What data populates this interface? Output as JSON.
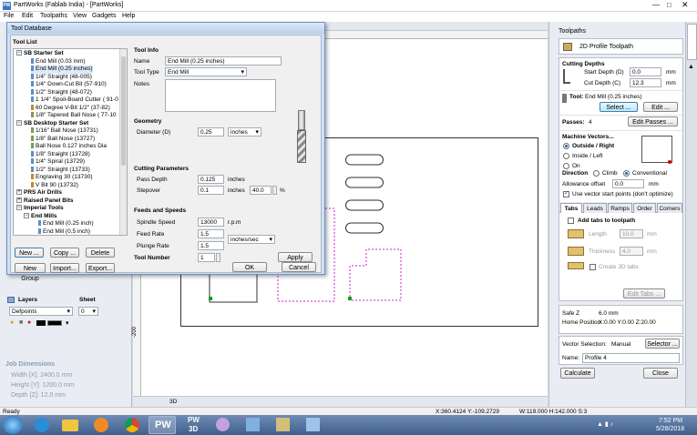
{
  "window": {
    "title": "PartWorks (Fablab India) - [PartWorks]",
    "menu": [
      "File",
      "Edit",
      "Toolpaths",
      "View",
      "Gadgets",
      "Help"
    ]
  },
  "tool_db": {
    "title": "Tool Database",
    "tool_list_label": "Tool List",
    "tree": [
      {
        "label": "SB Starter Set",
        "depth": 0,
        "bold": true,
        "expander": "−",
        "icon": ""
      },
      {
        "label": "End Mill (0.03 mm)",
        "depth": 2,
        "bold": false,
        "expander": "",
        "icon": "endmill"
      },
      {
        "label": "End Mill (0.25 inches)",
        "depth": 2,
        "bold": false,
        "expander": "",
        "icon": "endmill"
      },
      {
        "label": "1/4\" Straight  (48-005)",
        "depth": 2,
        "bold": false,
        "expander": "",
        "icon": "endmill"
      },
      {
        "label": "1/4\"  Down-Cut Bit (57-910)",
        "depth": 2,
        "bold": false,
        "expander": "",
        "icon": "endmill"
      },
      {
        "label": "1/2\" Straight  (48-072)",
        "depth": 2,
        "bold": false,
        "expander": "",
        "icon": "endmill"
      },
      {
        "label": "1 1/4\" Spoil-Board Cutter ( 91-0",
        "depth": 2,
        "bold": false,
        "expander": "",
        "icon": "endmill"
      },
      {
        "label": "60 Degree V-Bit  1/2\"  (37-82)",
        "depth": 2,
        "bold": false,
        "expander": "",
        "icon": "vbit"
      },
      {
        "label": "1/8\" Tapered Ball Nose  ( 77-10",
        "depth": 2,
        "bold": false,
        "expander": "",
        "icon": "ball"
      },
      {
        "label": "SB Desktop Starter Set",
        "depth": 0,
        "bold": true,
        "expander": "−",
        "icon": ""
      },
      {
        "label": "1/16\" Ball Nose (13731)",
        "depth": 2,
        "bold": false,
        "expander": "",
        "icon": "ball"
      },
      {
        "label": "1/8\" Ball Nose (13727)",
        "depth": 2,
        "bold": false,
        "expander": "",
        "icon": "ball"
      },
      {
        "label": "Ball Nose 0.127 inches Dia",
        "depth": 2,
        "bold": false,
        "expander": "",
        "icon": "ball"
      },
      {
        "label": "1/8\" Straight (13728)",
        "depth": 2,
        "bold": false,
        "expander": "",
        "icon": "endmill"
      },
      {
        "label": "1/4\" Spiral (13729)",
        "depth": 2,
        "bold": false,
        "expander": "",
        "icon": "endmill"
      },
      {
        "label": "1/2\" Straight (13733)",
        "depth": 2,
        "bold": false,
        "expander": "",
        "icon": "endmill"
      },
      {
        "label": "Engraving 30 (13730)",
        "depth": 2,
        "bold": false,
        "expander": "",
        "icon": "vbit"
      },
      {
        "label": "V Bit 90 (13732)",
        "depth": 2,
        "bold": false,
        "expander": "",
        "icon": "vbit"
      },
      {
        "label": "PRS Air Drills",
        "depth": 0,
        "bold": true,
        "expander": "+",
        "icon": ""
      },
      {
        "label": "Raised Panel Bits",
        "depth": 0,
        "bold": true,
        "expander": "+",
        "icon": ""
      },
      {
        "label": "Imperial Tools",
        "depth": 0,
        "bold": true,
        "expander": "−",
        "icon": ""
      },
      {
        "label": "End Mills",
        "depth": 1,
        "bold": true,
        "expander": "−",
        "icon": ""
      },
      {
        "label": "End Mill (0.25 inch)",
        "depth": 3,
        "bold": false,
        "expander": "",
        "icon": "endmill"
      },
      {
        "label": "End Mill (0.5 inch)",
        "depth": 3,
        "bold": false,
        "expander": "",
        "icon": "endmill"
      }
    ],
    "buttons": {
      "new": "New ...",
      "copy": "Copy ...",
      "delete": "Delete",
      "new_group": "New Group",
      "import": "Import...",
      "export": "Export..."
    },
    "tool_info": {
      "header": "Tool Info",
      "name_label": "Name",
      "name_value": "End Mill (0.25 inches)",
      "type_label": "Tool Type",
      "type_value": "End Mill",
      "notes_label": "Notes",
      "notes_value": ""
    },
    "geometry": {
      "header": "Geometry",
      "diameter_label": "Diameter (D)",
      "diameter_value": "0.25",
      "units_value": "inches"
    },
    "cutting": {
      "header": "Cutting Parameters",
      "pass_depth_label": "Pass Depth",
      "pass_depth_value": "0.125",
      "pass_depth_unit": "inches",
      "stepover_label": "Stepover",
      "stepover_value": "0.1",
      "stepover_unit": "inches",
      "stepover_pct": "40.0",
      "pct_sign": "%"
    },
    "feeds": {
      "header": "Feeds and Speeds",
      "spindle_label": "Spindle Speed",
      "spindle_value": "13000",
      "spindle_unit": "r.p.m",
      "feed_label": "Feed Rate",
      "feed_value": "1.5",
      "rate_units": "inches/sec",
      "plunge_label": "Plunge Rate",
      "plunge_value": "1.5"
    },
    "tool_number": {
      "label": "Tool Number",
      "value": "1"
    },
    "apply": "Apply",
    "ok": "OK",
    "cancel": "Cancel"
  },
  "layers": {
    "layers_label": "Layers",
    "sheet_label": "Sheet",
    "layer_value": "Defpoints",
    "sheet_value": "0"
  },
  "job": {
    "header": "Job Dimensions",
    "width": "Width  [X]: 2400.0 mm",
    "height": "Height [Y]: 1200.0 mm",
    "depth": "Depth  [Z]: 12.0 mm"
  },
  "canvas": {
    "tab_label": "3D",
    "ruler_label": "-200",
    "status_coords": "X:360.4124 Y:-109.2729",
    "status_wh": "W:119.000  H:142.000  S:3",
    "ready": "Ready"
  },
  "toolpaths": {
    "panel_title": "Toolpaths",
    "title": "2D Profile Toolpath",
    "cutting_depths": "Cutting Depths",
    "start_depth_label": "Start Depth (D)",
    "start_depth_value": "0.0",
    "start_depth_unit": "mm",
    "cut_depth_label": "Cut Depth (C)",
    "cut_depth_value": "12.3",
    "cut_depth_unit": "mm",
    "tool_label": "Tool:",
    "tool_value": "End Mill (0.25 inches)",
    "select": "Select ...",
    "edit": "Edit ...",
    "passes_label": "Passes:",
    "passes_value": "4",
    "edit_passes": "Edit Passes ...",
    "machine_vectors": "Machine Vectors...",
    "outside": "Outside / Right",
    "inside": "Inside / Left",
    "on": "On",
    "direction_label": "Direction",
    "climb": "Climb",
    "conventional": "Conventional",
    "allowance_label": "Allowance offset",
    "allowance_value": "0.0",
    "allowance_unit": "mm",
    "use_vector_start": "Use vector start points (don't optimize)",
    "tabs": [
      "Tabs",
      "Leads",
      "Ramps",
      "Order",
      "Corners"
    ],
    "add_tabs": "Add tabs to toolpath",
    "length_label": "Length",
    "length_value": "10.0",
    "length_unit": "mm",
    "thickness_label": "Thickness",
    "thickness_value": "4.0",
    "thickness_unit": "mm",
    "create_3d": "Create 3D tabs",
    "edit_tabs": "Edit Tabs ...",
    "safe_z": "Safe Z",
    "safe_z_value": "6.0 mm",
    "home_label": "Home Position",
    "home_value": "X:0.00 Y:0.00 Z:20.00",
    "vector_selection_label": "Vector Selection:",
    "vector_selection_value": "Manual",
    "selector": "Selector ...",
    "name_label": "Name:",
    "name_value": "Profile 4",
    "calculate": "Calculate",
    "close": "Close"
  },
  "taskbar": {
    "pw": "PW",
    "pw3d_top": "PW",
    "pw3d_bottom": "3D",
    "time": "7:52 PM",
    "date": "5/28/2018"
  }
}
